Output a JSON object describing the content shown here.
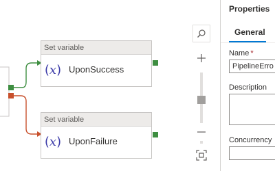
{
  "activities": [
    {
      "type_label": "Set variable",
      "name": "UponSuccess"
    },
    {
      "type_label": "Set variable",
      "name": "UponFailure"
    }
  ],
  "icons": {
    "zoom_fit": "search-icon",
    "zoom_in": "plus-icon",
    "zoom_out": "minus-icon",
    "fit_view": "fit-to-screen-icon",
    "activity": "variable-fx-icon"
  },
  "colors": {
    "success": "#3e8e41",
    "failure": "#c8502c",
    "accent": "#0078d4",
    "activity_icon": "#3b3aa8"
  },
  "properties": {
    "title": "Properties",
    "tabs": [
      {
        "label": "General",
        "active": true
      }
    ],
    "name_label": "Name",
    "name_required": "*",
    "name_value": "PipelineErro",
    "description_label": "Description",
    "concurrency_label": "Concurrency"
  }
}
